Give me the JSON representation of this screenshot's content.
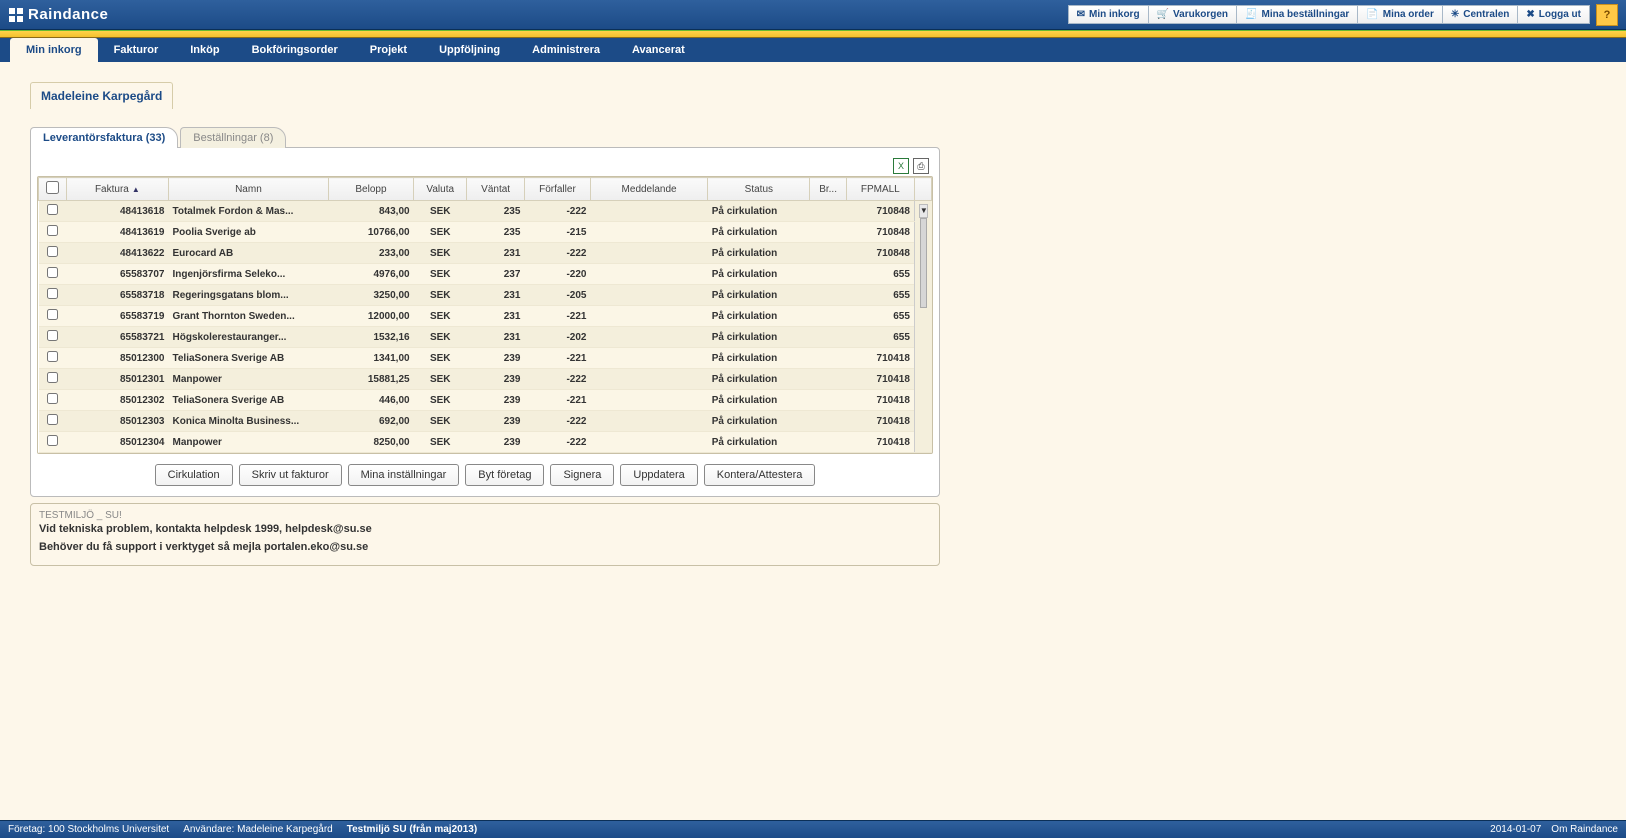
{
  "header": {
    "brand": "Raindance",
    "buttons": [
      {
        "label": "Min inkorg",
        "icon": "inbox"
      },
      {
        "label": "Varukorgen",
        "icon": "cart"
      },
      {
        "label": "Mina beställningar",
        "icon": "orders"
      },
      {
        "label": "Mina order",
        "icon": "order"
      },
      {
        "label": "Centralen",
        "icon": "central"
      },
      {
        "label": "Logga ut",
        "icon": "logout"
      }
    ],
    "help": "?"
  },
  "nav": {
    "tabs": [
      {
        "label": "Min inkorg",
        "active": true
      },
      {
        "label": "Fakturor"
      },
      {
        "label": "Inköp"
      },
      {
        "label": "Bokföringsorder"
      },
      {
        "label": "Projekt"
      },
      {
        "label": "Uppföljning"
      },
      {
        "label": "Administrera"
      },
      {
        "label": "Avancerat"
      }
    ]
  },
  "user": {
    "name": "Madeleine Karpegård"
  },
  "inner_tabs": [
    {
      "label": "Leverantörsfaktura (33)",
      "active": true
    },
    {
      "label": "Beställningar (8)"
    }
  ],
  "grid": {
    "columns": [
      "",
      "Faktura",
      "Namn",
      "Belopp",
      "Valuta",
      "Väntat",
      "Förfaller",
      "Meddelande",
      "Status",
      "Br...",
      "FPMALL"
    ],
    "sort_col": "Faktura",
    "rows": [
      {
        "faktura": "48413618",
        "namn": "Totalmek Fordon & Mas...",
        "belopp": "843,00",
        "valuta": "SEK",
        "vantat": "235",
        "forfaller": "-222",
        "meddelande": "",
        "status": "På cirkulation",
        "br": "",
        "fpmall": "710848"
      },
      {
        "faktura": "48413619",
        "namn": "Poolia Sverige ab",
        "belopp": "10766,00",
        "valuta": "SEK",
        "vantat": "235",
        "forfaller": "-215",
        "meddelande": "",
        "status": "På cirkulation",
        "br": "",
        "fpmall": "710848"
      },
      {
        "faktura": "48413622",
        "namn": "Eurocard AB",
        "belopp": "233,00",
        "valuta": "SEK",
        "vantat": "231",
        "forfaller": "-222",
        "meddelande": "",
        "status": "På cirkulation",
        "br": "",
        "fpmall": "710848"
      },
      {
        "faktura": "65583707",
        "namn": "Ingenjörsfirma Seleko...",
        "belopp": "4976,00",
        "valuta": "SEK",
        "vantat": "237",
        "forfaller": "-220",
        "meddelande": "",
        "status": "På cirkulation",
        "br": "",
        "fpmall": "655"
      },
      {
        "faktura": "65583718",
        "namn": "Regeringsgatans blom...",
        "belopp": "3250,00",
        "valuta": "SEK",
        "vantat": "231",
        "forfaller": "-205",
        "meddelande": "",
        "status": "På cirkulation",
        "br": "",
        "fpmall": "655"
      },
      {
        "faktura": "65583719",
        "namn": "Grant Thornton Sweden...",
        "belopp": "12000,00",
        "valuta": "SEK",
        "vantat": "231",
        "forfaller": "-221",
        "meddelande": "",
        "status": "På cirkulation",
        "br": "",
        "fpmall": "655"
      },
      {
        "faktura": "65583721",
        "namn": "Högskolerestauranger...",
        "belopp": "1532,16",
        "valuta": "SEK",
        "vantat": "231",
        "forfaller": "-202",
        "meddelande": "",
        "status": "På cirkulation",
        "br": "",
        "fpmall": "655"
      },
      {
        "faktura": "85012300",
        "namn": "TeliaSonera Sverige AB",
        "belopp": "1341,00",
        "valuta": "SEK",
        "vantat": "239",
        "forfaller": "-221",
        "meddelande": "",
        "status": "På cirkulation",
        "br": "",
        "fpmall": "710418"
      },
      {
        "faktura": "85012301",
        "namn": "Manpower",
        "belopp": "15881,25",
        "valuta": "SEK",
        "vantat": "239",
        "forfaller": "-222",
        "meddelande": "",
        "status": "På cirkulation",
        "br": "",
        "fpmall": "710418"
      },
      {
        "faktura": "85012302",
        "namn": "TeliaSonera Sverige AB",
        "belopp": "446,00",
        "valuta": "SEK",
        "vantat": "239",
        "forfaller": "-221",
        "meddelande": "",
        "status": "På cirkulation",
        "br": "",
        "fpmall": "710418"
      },
      {
        "faktura": "85012303",
        "namn": "Konica Minolta Business...",
        "belopp": "692,00",
        "valuta": "SEK",
        "vantat": "239",
        "forfaller": "-222",
        "meddelande": "",
        "status": "På cirkulation",
        "br": "",
        "fpmall": "710418"
      },
      {
        "faktura": "85012304",
        "namn": "Manpower",
        "belopp": "8250,00",
        "valuta": "SEK",
        "vantat": "239",
        "forfaller": "-222",
        "meddelande": "",
        "status": "På cirkulation",
        "br": "",
        "fpmall": "710418"
      }
    ]
  },
  "actions": [
    "Cirkulation",
    "Skriv ut fakturor",
    "Mina inställningar",
    "Byt företag",
    "Signera",
    "Uppdatera",
    "Kontera/Attestera"
  ],
  "infobox": {
    "title": "TESTMILJÖ _ SU!",
    "line1": "Vid tekniska problem, kontakta helpdesk 1999, helpdesk@su.se",
    "line2": "Behöver du få support i verktyget så mejla portalen.eko@su.se"
  },
  "footer": {
    "company": "Företag: 100 Stockholms Universitet",
    "user": "Användare: Madeleine Karpegård",
    "env": "Testmiljö SU (från maj2013)",
    "date": "2014-01-07",
    "about": "Om Raindance"
  }
}
